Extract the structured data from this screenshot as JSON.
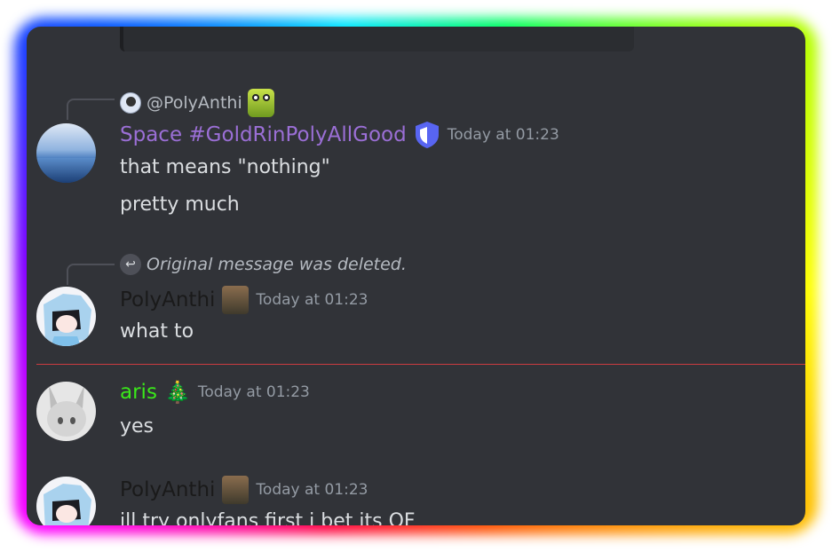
{
  "colors": {
    "background": "#313338",
    "text": "#dbdee1",
    "muted": "#949ba4",
    "space_name": "#9b6fd6",
    "polyanthi_name": "#1a1a1a",
    "aris_name": "#3ae81a",
    "role_shield": "#5865f2",
    "new_divider": "#f23f43"
  },
  "messages": [
    {
      "reply": {
        "author": "@PolyAnthi",
        "avatar_icon": "anime-avatar-icon",
        "emoji": "frog-emoji-icon"
      },
      "author": "Space #GoldRinPolyAllGood",
      "role_icon": "shield-icon",
      "timestamp": "Today at 01:23",
      "lines": [
        "that means \"nothing\"",
        "pretty much"
      ]
    },
    {
      "reply": {
        "deleted_text": "Original message was deleted."
      },
      "author": "PolyAnthi",
      "emoji": "soldier-emoji-icon",
      "timestamp": "Today at 01:23",
      "lines": [
        "what to"
      ]
    },
    {
      "author": "aris",
      "emoji": "christmas-tree-emoji-icon",
      "emoji_glyph": "🎄",
      "timestamp": "Today at 01:23",
      "lines": [
        "yes"
      ]
    },
    {
      "author": "PolyAnthi",
      "emoji": "soldier-emoji-icon",
      "timestamp": "Today at 01:23",
      "lines": [
        "ill try onlyfans first i bet its OF"
      ]
    }
  ]
}
